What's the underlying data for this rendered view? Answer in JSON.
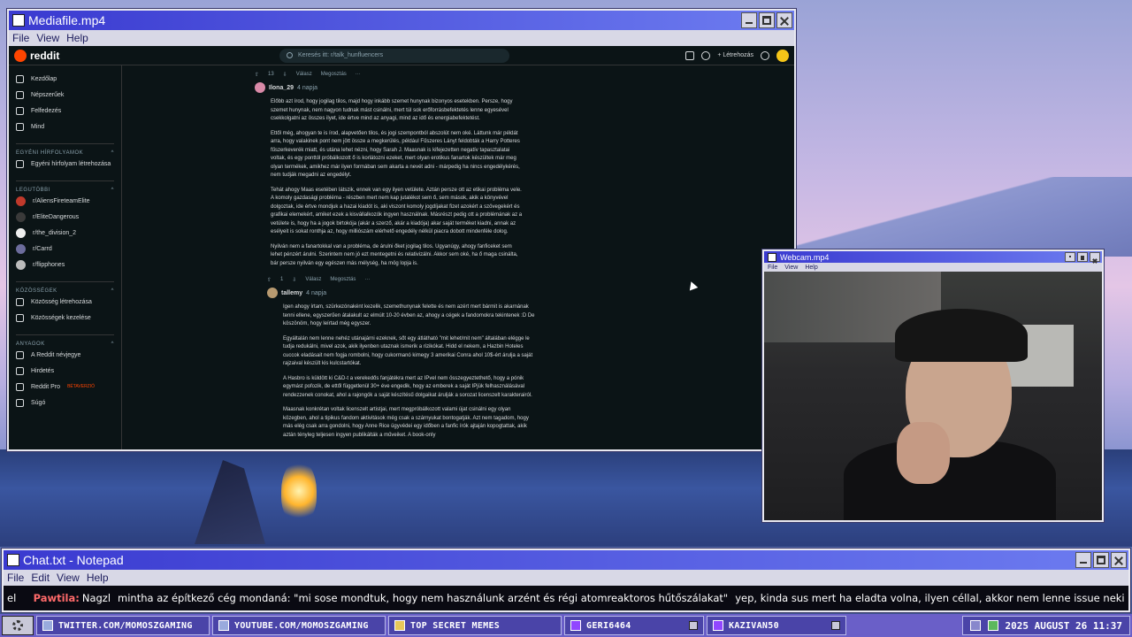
{
  "media_window": {
    "title": "Mediafile.mp4",
    "menu": [
      "File",
      "View",
      "Help"
    ]
  },
  "reddit": {
    "logo": "reddit",
    "search_placeholder": "Keresés itt: r/talk_hunfluencers",
    "create_label": "Létrehozás",
    "sidebar": {
      "items": [
        "Kezdőlap",
        "Népszerűek",
        "Felfedezés",
        "Mind"
      ],
      "sections": [
        {
          "title": "EGYÉNI HÍRFOLYAMOK",
          "items": [
            "Egyéni hírfolyam létrehozása"
          ]
        },
        {
          "title": "LEGUTÓBBI",
          "items": [
            "r/AliensFireteamElite",
            "r/EliteDangerous",
            "r/the_division_2",
            "r/Carrd",
            "r/flipphones"
          ]
        },
        {
          "title": "KÖZÖSSÉGEK",
          "items": [
            "Közösség létrehozása",
            "Közösségek kezelése"
          ]
        },
        {
          "title": "ANYAGOK",
          "items": [
            "A Reddit névjegye",
            "Hirdetés",
            "Reddit Pro",
            "Súgó"
          ]
        }
      ],
      "beta_label": "BÉTAVERZIÓ"
    },
    "top_actions": {
      "votes": "13",
      "reply": "Válasz",
      "share": "Megosztás"
    },
    "comment1": {
      "user": "Ilona_29",
      "time": "4 napja",
      "paragraphs": [
        "Előbb azt írod, hogy jogilag tilos, majd hogy inkább szemet hunynak bizonyos esetekben. Persze, hogy szemet hunynak, nem nagyon tudnak mást csinálni, mert túl sok erőforrásbefektetés lenne egyesével csekkolgatni az összes ilyet, ide értve mind az anyagi, mind az idő és energiabefektetést.",
        "Ettől még, ahogyan te is írod, alapvetően tilos, és jogi szempontból abszolút nem oké. Láttunk már példát arra, hogy valakinek pont nem jött össze a megkerülés, például Fűszeres Lányt feldobták a Harry Potteres fűszerkeverék miatt, és utána lehet nézni, hogy Sarah J. Maasnak is kifejezetten negatív tapasztalatai voltak, és egy ponttól próbálkozott ő is korlátozni ezeket, mert olyan erotikus fanartok készültek már meg olyan termékek, amikhez már ilyen formában sem akarta a nevét adni - márpedig ha nincs engedélykérés, nem tudják megadni az engedélyt.",
        "Tehát ahogy Maas esetében látszik, ennek van egy ilyen vetülete. Aztán persze ott az etikai probléma vele. A komoly gazdasági probléma - részben mert nem kap jutalékot sem ő, sem mások, akik a könyvével dolgoztak, ide értve mondjuk a hazai kiadót is, aki viszont komoly jogdíjakat fizet azokért a szövegekért és grafikai elemekért, amiket ezek a kisvállalkozók ingyen használnak. Másrészt pedig ott a problémának az a vetülete is, hogy ha a jogok birtokója (akár a szerző, akár a kiadója) akar saját terméket kiadni, annak az esélyeit is sokat ronthja az, hogy milliószám elérhető engedély nélkül piacra dobott mindenféle dolog.",
        "Nyilván nem a fanartokkal van a probléma, de árulni őket jogilag tilos. Ugyanúgy, ahogy fanficeket sem lehet pénzért árulni. Szerintem nem jó ezt mentegetni és relativizálni. Akkor sem oké, ha ő maga csinálta, bár persze nyilván egy egészen más mélység, ha mög lopja is."
      ],
      "votes": "1",
      "reply": "Válasz",
      "share": "Megosztás"
    },
    "comment2": {
      "user": "tallemy",
      "time": "4 napja",
      "paragraphs": [
        "Igen ahogy írtam, szürkezónaként kezelik, szemethunynak felette és nem azért mert bármit is akarnának tenni ellene, egyszerűen átalakult az elmúlt 10-20 évben az, ahogy a cégek a fandomokra tekintenek :D De köszönöm, hogy leírtad még egyszer.",
        "Egyáltalán nem lenne nehéz utánajárni ezeknek, sőt egy átlátható \"mit lehet/mit nem\" általában elégge le tudja redukálni, mivel azok, akik ilyenben utaznak ismerik a rizikókat. Hidd el nekem, a Hazbin Hoteles cuccok eladásait nem fogja rombolni, hogy cukormanó kimegy 3 amerikai Conra ahol 10$-ért árulja a saját rajzaival készült kis kulcstartókat.",
        "A Hasbro is küldött ki C&D-t a verekedős fanjátékra mert az IPvel nem összegyeztethető, hogy a pónik egymást pofozik, de ettől függetlenül 30+ éve engedik, hogy az emberek a saját IPjük felhasználásával rendezzenek conokat, ahol a rajongók a saját készítésű dolgaikat árulják a sorozat licenszelt karakterairól.",
        "Maasnak konkrétan voltak licenszelt artistjai, mert megpróbálkozott valami újat csinálni egy olyan közegben, ahol a tipikus fandom aktivitások még csak a szárnyukat bontogatják. Azt nem tagadom, hogy más elég csak arra gondolni, hogy Anne Rice ügyvédei egy időben a fanfic írók ajtaján kopogtattak, akik aztán tényleg teljesen ingyen publikálták a műveiket. A book-only"
      ]
    }
  },
  "webcam_window": {
    "title": "Webcam.mp4",
    "menu": [
      "File",
      "View",
      "Help"
    ]
  },
  "chat_window": {
    "title": "Chat.txt - Notepad",
    "menu": [
      "File",
      "Edit",
      "View",
      "Help"
    ],
    "ticker_prefix": "el",
    "ticker_name": "Pawtila:",
    "ticker_text1": "Nagzl",
    "ticker_text2": "mintha az építkező cég mondaná: \"mi sose mondtuk, hogy nem használunk arzént és régi atomreaktoros hűtőszálakat\"",
    "ticker_text3": "yep, kinda sus    mert ha eladta volna, ilyen céllal, akkor nem lenne issue neki    mennyibe kerül?    az komoly"
  },
  "taskbar": {
    "tasks": [
      "TWITTER.COM/MOMOSZGAMING",
      "YOUTUBE.COM/MOMOSZGAMING",
      "TOP SECRET MEMES",
      "GERI6464",
      "KAZIVAN50"
    ],
    "clock": "2025 AUGUST 26 11:37"
  }
}
